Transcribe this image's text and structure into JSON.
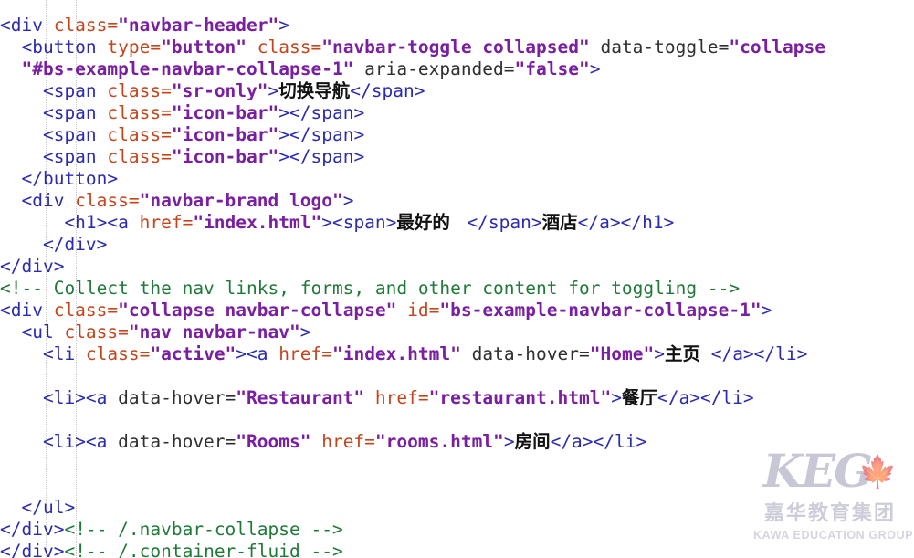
{
  "editor": {
    "language": "html",
    "background": "#ffffff",
    "indent_guide_positions": [
      17,
      50,
      83
    ],
    "theme_colors": {
      "tag": "#2b2bb0",
      "attribute": "#c4451c",
      "attribute_plain": "#2f2f2f",
      "value": "#7a1fa2",
      "comment": "#1f7a38",
      "text": "#111111",
      "indent_guide": "#c9c9c9"
    }
  },
  "code": {
    "lines": [
      {
        "id": "line-partial-top",
        "partial": true,
        "tokens": [
          {
            "t": "tag",
            "s": ""
          }
        ]
      },
      {
        "id": "line-navbar-header-open",
        "tokens": [
          {
            "t": "tag",
            "s": "<div "
          },
          {
            "t": "attr",
            "s": "class="
          },
          {
            "t": "val",
            "s": "\"navbar-header\""
          },
          {
            "t": "tag",
            "s": ">"
          }
        ]
      },
      {
        "id": "line-button-open",
        "tokens": [
          {
            "t": "tag",
            "s": "  <button "
          },
          {
            "t": "attr",
            "s": "type="
          },
          {
            "t": "val",
            "s": "\"button\""
          },
          {
            "t": "attr",
            "s": " class="
          },
          {
            "t": "val",
            "s": "\"navbar-toggle collapsed\""
          },
          {
            "t": "attr-dk",
            "s": " data-toggle="
          },
          {
            "t": "val",
            "s": "\"collapse"
          }
        ]
      },
      {
        "id": "line-button-open-cont",
        "tokens": [
          {
            "t": "val",
            "s": "  \"#bs-example-navbar-collapse-1\""
          },
          {
            "t": "attr-dk",
            "s": " aria-expanded="
          },
          {
            "t": "val",
            "s": "\"false\""
          },
          {
            "t": "tag",
            "s": ">"
          }
        ]
      },
      {
        "id": "line-span-sr-only",
        "tokens": [
          {
            "t": "tag",
            "s": "    <span "
          },
          {
            "t": "attr",
            "s": "class="
          },
          {
            "t": "val",
            "s": "\"sr-only\""
          },
          {
            "t": "tag",
            "s": ">"
          },
          {
            "t": "cjk",
            "s": "切换导航"
          },
          {
            "t": "tag",
            "s": "</span>"
          }
        ]
      },
      {
        "id": "line-icon-bar-1",
        "tokens": [
          {
            "t": "tag",
            "s": "    <span "
          },
          {
            "t": "attr",
            "s": "class="
          },
          {
            "t": "val",
            "s": "\"icon-bar\""
          },
          {
            "t": "tag",
            "s": "></span>"
          }
        ]
      },
      {
        "id": "line-icon-bar-2",
        "tokens": [
          {
            "t": "tag",
            "s": "    <span "
          },
          {
            "t": "attr",
            "s": "class="
          },
          {
            "t": "val",
            "s": "\"icon-bar\""
          },
          {
            "t": "tag",
            "s": "></span>"
          }
        ]
      },
      {
        "id": "line-icon-bar-3",
        "tokens": [
          {
            "t": "tag",
            "s": "    <span "
          },
          {
            "t": "attr",
            "s": "class="
          },
          {
            "t": "val",
            "s": "\"icon-bar\""
          },
          {
            "t": "tag",
            "s": "></span>"
          }
        ]
      },
      {
        "id": "line-button-close",
        "tokens": [
          {
            "t": "tag",
            "s": "  </button>"
          }
        ]
      },
      {
        "id": "line-navbar-brand-open",
        "tokens": [
          {
            "t": "tag",
            "s": "  <div "
          },
          {
            "t": "attr",
            "s": "class="
          },
          {
            "t": "val",
            "s": "\"navbar-brand logo\""
          },
          {
            "t": "tag",
            "s": ">"
          }
        ]
      },
      {
        "id": "line-h1-brand",
        "tokens": [
          {
            "t": "tag",
            "s": "      <h1><a "
          },
          {
            "t": "attr",
            "s": "href="
          },
          {
            "t": "val",
            "s": "\"index.html\""
          },
          {
            "t": "tag",
            "s": "><span>"
          },
          {
            "t": "cjk",
            "s": "最好的 "
          },
          {
            "t": "tag",
            "s": " </span>"
          },
          {
            "t": "cjk",
            "s": "酒店"
          },
          {
            "t": "tag",
            "s": "</a></h1>"
          }
        ]
      },
      {
        "id": "line-brand-div-close",
        "tokens": [
          {
            "t": "tag",
            "s": "    </div>"
          }
        ]
      },
      {
        "id": "line-navbar-header-close",
        "tokens": [
          {
            "t": "tag",
            "s": "</div>"
          }
        ]
      },
      {
        "id": "line-comment-collect",
        "tokens": [
          {
            "t": "comment",
            "s": "<!-- Collect the nav links, forms, and other content for toggling -->"
          }
        ]
      },
      {
        "id": "line-collapse-div-open",
        "tokens": [
          {
            "t": "tag",
            "s": "<div "
          },
          {
            "t": "attr",
            "s": "class="
          },
          {
            "t": "val",
            "s": "\"collapse navbar-collapse\""
          },
          {
            "t": "attr",
            "s": " id="
          },
          {
            "t": "val",
            "s": "\"bs-example-navbar-collapse-1\""
          },
          {
            "t": "tag",
            "s": ">"
          }
        ]
      },
      {
        "id": "line-ul-open",
        "tokens": [
          {
            "t": "tag",
            "s": "  <ul "
          },
          {
            "t": "attr",
            "s": "class="
          },
          {
            "t": "val",
            "s": "\"nav navbar-nav\""
          },
          {
            "t": "tag",
            "s": ">"
          }
        ]
      },
      {
        "id": "line-li-home",
        "tokens": [
          {
            "t": "tag",
            "s": "    <li "
          },
          {
            "t": "attr",
            "s": "class="
          },
          {
            "t": "val",
            "s": "\"active\""
          },
          {
            "t": "tag",
            "s": "><a "
          },
          {
            "t": "attr",
            "s": "href="
          },
          {
            "t": "val",
            "s": "\"index.html\""
          },
          {
            "t": "attr-dk",
            "s": " data-hover="
          },
          {
            "t": "val",
            "s": "\"Home\""
          },
          {
            "t": "tag",
            "s": ">"
          },
          {
            "t": "cjk",
            "s": "主页"
          },
          {
            "t": "tag",
            "s": " </a></li>"
          }
        ]
      },
      {
        "id": "line-blank-1",
        "tokens": [
          {
            "t": "tag",
            "s": ""
          }
        ]
      },
      {
        "id": "line-li-restaurant",
        "tokens": [
          {
            "t": "tag",
            "s": "    <li><a "
          },
          {
            "t": "attr-dk",
            "s": "data-hover="
          },
          {
            "t": "val",
            "s": "\"Restaurant\""
          },
          {
            "t": "attr",
            "s": " href="
          },
          {
            "t": "val",
            "s": "\"restaurant.html\""
          },
          {
            "t": "tag",
            "s": ">"
          },
          {
            "t": "cjk",
            "s": "餐厅"
          },
          {
            "t": "tag",
            "s": "</a></li>"
          }
        ]
      },
      {
        "id": "line-blank-2",
        "tokens": [
          {
            "t": "tag",
            "s": ""
          }
        ]
      },
      {
        "id": "line-li-rooms",
        "tokens": [
          {
            "t": "tag",
            "s": "    <li><a "
          },
          {
            "t": "attr-dk",
            "s": "data-hover="
          },
          {
            "t": "val",
            "s": "\"Rooms\""
          },
          {
            "t": "attr",
            "s": " href="
          },
          {
            "t": "val",
            "s": "\"rooms.html\""
          },
          {
            "t": "tag",
            "s": ">"
          },
          {
            "t": "cjk",
            "s": "房间"
          },
          {
            "t": "tag",
            "s": "</a></li>"
          }
        ]
      },
      {
        "id": "line-blank-3",
        "tokens": [
          {
            "t": "tag",
            "s": ""
          }
        ]
      },
      {
        "id": "line-blank-4",
        "tokens": [
          {
            "t": "tag",
            "s": ""
          }
        ]
      },
      {
        "id": "line-ul-close",
        "tokens": [
          {
            "t": "tag",
            "s": "  </ul>"
          }
        ]
      },
      {
        "id": "line-collapse-div-close",
        "tokens": [
          {
            "t": "tag",
            "s": "</div>"
          },
          {
            "t": "comment",
            "s": "<!-- /.navbar-collapse -->"
          }
        ]
      },
      {
        "id": "line-partial-bottom",
        "partial": true,
        "tokens": [
          {
            "t": "tag",
            "s": "</div>"
          },
          {
            "t": "comment",
            "s": "<!-- /.container-fluid -->"
          }
        ]
      }
    ]
  },
  "watermark": {
    "logo_text": "KEG",
    "leaf_icon": "maple-leaf-icon",
    "company_cn": "嘉华教育集团",
    "company_en": "KAWA EDUCATION GROUP",
    "color": "#9a9ab4"
  }
}
